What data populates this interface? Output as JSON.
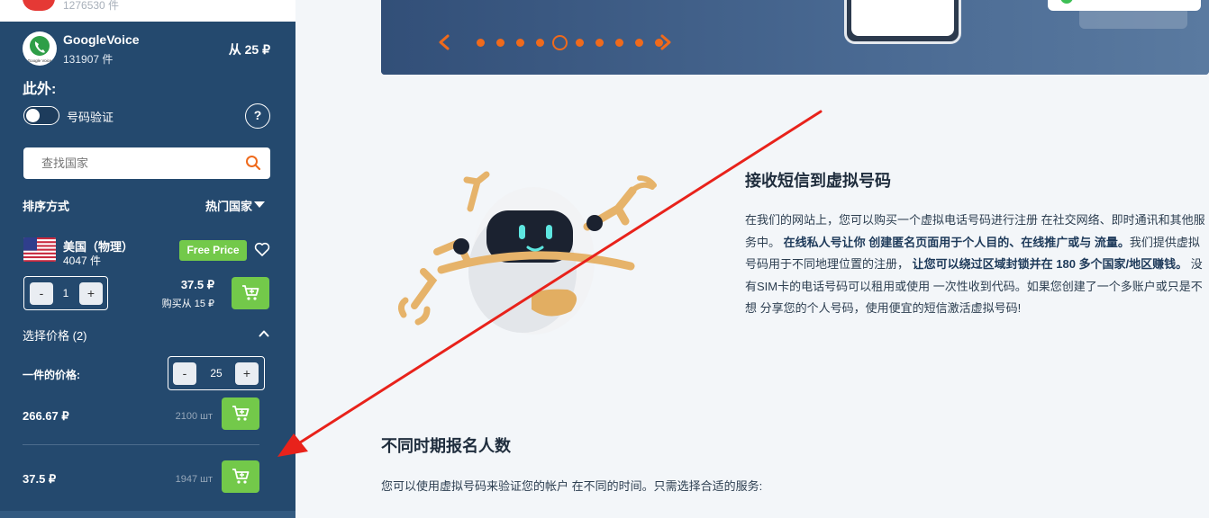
{
  "prev_service": {
    "count": "1276530 件"
  },
  "service": {
    "name": "GoogleVoice",
    "count": "131907 件",
    "price": "从 25 ₽",
    "logo_icon": "phone-icon",
    "logo_text": "Google Voice"
  },
  "filters": {
    "also_label": "此外:",
    "number_verify_label": "号码验证",
    "help_symbol": "?",
    "search_placeholder": "查找国家",
    "sort_label": "排序方式",
    "sort_value": "热门国家"
  },
  "country": {
    "name": "美国（物理）",
    "count": "4047 件",
    "badge": "Free Price",
    "qty": "1",
    "minus": "-",
    "plus": "+",
    "price": "37.5 ₽",
    "buy_from": "购买从 15 ₽"
  },
  "price_select": {
    "label": "选择价格 (2)",
    "unit_label": "一件的价格:",
    "unit_value": "25",
    "tiers": [
      {
        "price": "266.67 ₽",
        "stock": "2100 шт"
      },
      {
        "price": "37.5 ₽",
        "stock": "1947 шт"
      }
    ]
  },
  "carousel": {
    "dot_count": 10,
    "active_dot": 4,
    "accent": "#ef6a1c"
  },
  "sms_section": {
    "title": "接收短信到虚拟号码",
    "p1": "在我们的网站上，您可以购买一个虚拟电话号码进行注册 在社交网络、即时通讯和其他服务中。",
    "b1": "在线私人号让你 创建匿名页面用于个人目的、在线推广或与 流量。",
    "p2": "我们提供虚拟号码用于不同地理位置的注册，",
    "b2": "让您可以绕过区域封锁并在 180 多个国家/地区赚钱。",
    "p3": "没有SIM卡的电话号码可以租用或使用 一次性收到代码。如果您创建了一个多账户或只是不想 分享您的个人号码，使用便宜的短信激活虚拟号码!"
  },
  "diff_section": {
    "title": "不同时期报名人数",
    "text": "您可以使用虚拟号码来验证您的帐户 在不同的时间。只需选择合适的服务:"
  },
  "colors": {
    "sidebar": "#24496e",
    "green": "#73c94a",
    "annotation": "#e8221b"
  }
}
